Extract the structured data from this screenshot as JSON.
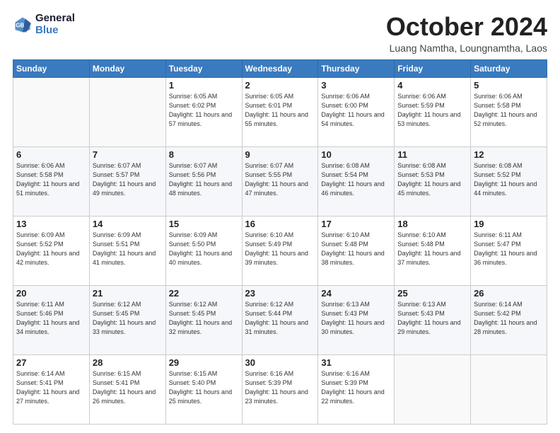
{
  "header": {
    "logo_line1": "General",
    "logo_line2": "Blue",
    "month_title": "October 2024",
    "subtitle": "Luang Namtha, Loungnamtha, Laos"
  },
  "days_of_week": [
    "Sunday",
    "Monday",
    "Tuesday",
    "Wednesday",
    "Thursday",
    "Friday",
    "Saturday"
  ],
  "weeks": [
    [
      {
        "day": "",
        "info": ""
      },
      {
        "day": "",
        "info": ""
      },
      {
        "day": "1",
        "info": "Sunrise: 6:05 AM\nSunset: 6:02 PM\nDaylight: 11 hours and 57 minutes."
      },
      {
        "day": "2",
        "info": "Sunrise: 6:05 AM\nSunset: 6:01 PM\nDaylight: 11 hours and 55 minutes."
      },
      {
        "day": "3",
        "info": "Sunrise: 6:06 AM\nSunset: 6:00 PM\nDaylight: 11 hours and 54 minutes."
      },
      {
        "day": "4",
        "info": "Sunrise: 6:06 AM\nSunset: 5:59 PM\nDaylight: 11 hours and 53 minutes."
      },
      {
        "day": "5",
        "info": "Sunrise: 6:06 AM\nSunset: 5:58 PM\nDaylight: 11 hours and 52 minutes."
      }
    ],
    [
      {
        "day": "6",
        "info": "Sunrise: 6:06 AM\nSunset: 5:58 PM\nDaylight: 11 hours and 51 minutes."
      },
      {
        "day": "7",
        "info": "Sunrise: 6:07 AM\nSunset: 5:57 PM\nDaylight: 11 hours and 49 minutes."
      },
      {
        "day": "8",
        "info": "Sunrise: 6:07 AM\nSunset: 5:56 PM\nDaylight: 11 hours and 48 minutes."
      },
      {
        "day": "9",
        "info": "Sunrise: 6:07 AM\nSunset: 5:55 PM\nDaylight: 11 hours and 47 minutes."
      },
      {
        "day": "10",
        "info": "Sunrise: 6:08 AM\nSunset: 5:54 PM\nDaylight: 11 hours and 46 minutes."
      },
      {
        "day": "11",
        "info": "Sunrise: 6:08 AM\nSunset: 5:53 PM\nDaylight: 11 hours and 45 minutes."
      },
      {
        "day": "12",
        "info": "Sunrise: 6:08 AM\nSunset: 5:52 PM\nDaylight: 11 hours and 44 minutes."
      }
    ],
    [
      {
        "day": "13",
        "info": "Sunrise: 6:09 AM\nSunset: 5:52 PM\nDaylight: 11 hours and 42 minutes."
      },
      {
        "day": "14",
        "info": "Sunrise: 6:09 AM\nSunset: 5:51 PM\nDaylight: 11 hours and 41 minutes."
      },
      {
        "day": "15",
        "info": "Sunrise: 6:09 AM\nSunset: 5:50 PM\nDaylight: 11 hours and 40 minutes."
      },
      {
        "day": "16",
        "info": "Sunrise: 6:10 AM\nSunset: 5:49 PM\nDaylight: 11 hours and 39 minutes."
      },
      {
        "day": "17",
        "info": "Sunrise: 6:10 AM\nSunset: 5:48 PM\nDaylight: 11 hours and 38 minutes."
      },
      {
        "day": "18",
        "info": "Sunrise: 6:10 AM\nSunset: 5:48 PM\nDaylight: 11 hours and 37 minutes."
      },
      {
        "day": "19",
        "info": "Sunrise: 6:11 AM\nSunset: 5:47 PM\nDaylight: 11 hours and 36 minutes."
      }
    ],
    [
      {
        "day": "20",
        "info": "Sunrise: 6:11 AM\nSunset: 5:46 PM\nDaylight: 11 hours and 34 minutes."
      },
      {
        "day": "21",
        "info": "Sunrise: 6:12 AM\nSunset: 5:45 PM\nDaylight: 11 hours and 33 minutes."
      },
      {
        "day": "22",
        "info": "Sunrise: 6:12 AM\nSunset: 5:45 PM\nDaylight: 11 hours and 32 minutes."
      },
      {
        "day": "23",
        "info": "Sunrise: 6:12 AM\nSunset: 5:44 PM\nDaylight: 11 hours and 31 minutes."
      },
      {
        "day": "24",
        "info": "Sunrise: 6:13 AM\nSunset: 5:43 PM\nDaylight: 11 hours and 30 minutes."
      },
      {
        "day": "25",
        "info": "Sunrise: 6:13 AM\nSunset: 5:43 PM\nDaylight: 11 hours and 29 minutes."
      },
      {
        "day": "26",
        "info": "Sunrise: 6:14 AM\nSunset: 5:42 PM\nDaylight: 11 hours and 28 minutes."
      }
    ],
    [
      {
        "day": "27",
        "info": "Sunrise: 6:14 AM\nSunset: 5:41 PM\nDaylight: 11 hours and 27 minutes."
      },
      {
        "day": "28",
        "info": "Sunrise: 6:15 AM\nSunset: 5:41 PM\nDaylight: 11 hours and 26 minutes."
      },
      {
        "day": "29",
        "info": "Sunrise: 6:15 AM\nSunset: 5:40 PM\nDaylight: 11 hours and 25 minutes."
      },
      {
        "day": "30",
        "info": "Sunrise: 6:16 AM\nSunset: 5:39 PM\nDaylight: 11 hours and 23 minutes."
      },
      {
        "day": "31",
        "info": "Sunrise: 6:16 AM\nSunset: 5:39 PM\nDaylight: 11 hours and 22 minutes."
      },
      {
        "day": "",
        "info": ""
      },
      {
        "day": "",
        "info": ""
      }
    ]
  ]
}
